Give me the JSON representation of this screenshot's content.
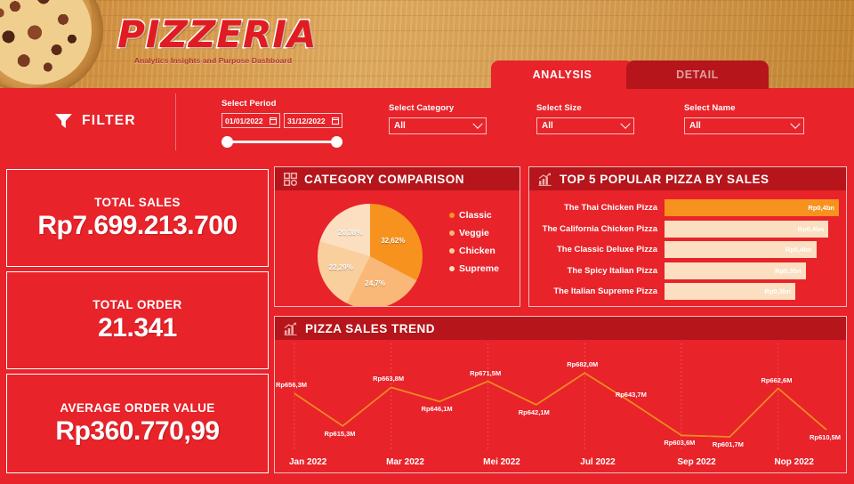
{
  "header": {
    "logo_text": "PIZZERIA",
    "tagline": "Analytics Insights and Purpose Dashboard"
  },
  "tabs": [
    {
      "label": "ANALYSIS",
      "active": true
    },
    {
      "label": "DETAIL",
      "active": false
    }
  ],
  "filter": {
    "title": "FILTER",
    "period": {
      "label": "Select Period",
      "start": "01/01/2022",
      "end": "31/12/2022"
    },
    "category": {
      "label": "Select Category",
      "value": "All"
    },
    "size": {
      "label": "Select Size",
      "value": "All"
    },
    "name": {
      "label": "Select Name",
      "value": "All"
    }
  },
  "kpis": [
    {
      "caption": "TOTAL SALES",
      "value": "Rp7.699.213.700"
    },
    {
      "caption": "TOTAL ORDER",
      "value": "21.341"
    },
    {
      "caption": "AVERAGE ORDER VALUE",
      "value": "Rp360.770,99"
    }
  ],
  "panels": {
    "category": "CATEGORY COMPARISON",
    "top5": "TOP 5 POPULAR PIZZA BY SALES",
    "trend": "PIZZA SALES TREND"
  },
  "colors": {
    "brand_red": "#E8232A",
    "dark_red": "#B5151B",
    "orange": "#F7921E",
    "peach1": "#F9B878",
    "peach2": "#FACF9E",
    "peach3": "#FBDFC0"
  },
  "chart_data": [
    {
      "type": "pie",
      "title": "CATEGORY COMPARISON",
      "categories": [
        "Classic",
        "Veggie",
        "Chicken",
        "Supreme"
      ],
      "values": [
        32.62,
        24.7,
        22.29,
        20.38
      ],
      "labels": [
        "32,62%",
        "24,7%",
        "22,29%",
        "20,38%"
      ],
      "colors": [
        "#F7921E",
        "#F9B878",
        "#FACF9E",
        "#FBDFC0"
      ],
      "legend_position": "right",
      "unit": "%"
    },
    {
      "type": "bar",
      "orientation": "horizontal",
      "title": "TOP 5 POPULAR PIZZA BY SALES",
      "categories": [
        "The Thai Chicken Pizza",
        "The California Chicken Pizza",
        "The Classic Deluxe Pizza",
        "The Spicy Italian Pizza",
        "The Italian Supreme Pizza"
      ],
      "values": [
        0.44,
        0.42,
        0.4,
        0.38,
        0.36
      ],
      "labels": [
        "Rp0,4bn",
        "Rp0,4bn",
        "Rp0,4bn",
        "Rp0,3bn",
        "Rp0,3bn"
      ],
      "bar_widths_pct": [
        100,
        94,
        87,
        81,
        75
      ],
      "colors": [
        "#F7921E",
        "#FBDFC0",
        "#FBDFC0",
        "#FBDFC0",
        "#FBDFC0"
      ],
      "xlabel": "",
      "ylabel": "",
      "grid": false
    },
    {
      "type": "line",
      "title": "PIZZA SALES TREND",
      "x": [
        "Jan 2022",
        "Feb 2022",
        "Mar 2022",
        "Apr 2022",
        "Mei 2022",
        "Jun 2022",
        "Jul 2022",
        "Agu 2022",
        "Sep 2022",
        "Okt 2022",
        "Nop 2022",
        "Des 2022"
      ],
      "x_ticks": [
        "Jan 2022",
        "Mar 2022",
        "Mei 2022",
        "Jul 2022",
        "Sep 2022",
        "Nop 2022"
      ],
      "values": [
        656.3,
        615.3,
        663.8,
        646.1,
        671.5,
        642.1,
        682.0,
        643.7,
        603.6,
        601.7,
        662.6,
        610.5
      ],
      "labels": [
        "Rp656,3M",
        "Rp615,3M",
        "Rp663,8M",
        "Rp646,1M",
        "Rp671,5M",
        "Rp642,1M",
        "Rp682,0M",
        "Rp643,7M",
        "Rp603,6M",
        "Rp601,7M",
        "Rp662,6M",
        "Rp610,5M"
      ],
      "ylim": [
        595,
        690
      ],
      "unit": "M",
      "line_color": "#F08A20",
      "xlabel": "",
      "ylabel": "",
      "grid": false,
      "legend_position": "none"
    }
  ]
}
